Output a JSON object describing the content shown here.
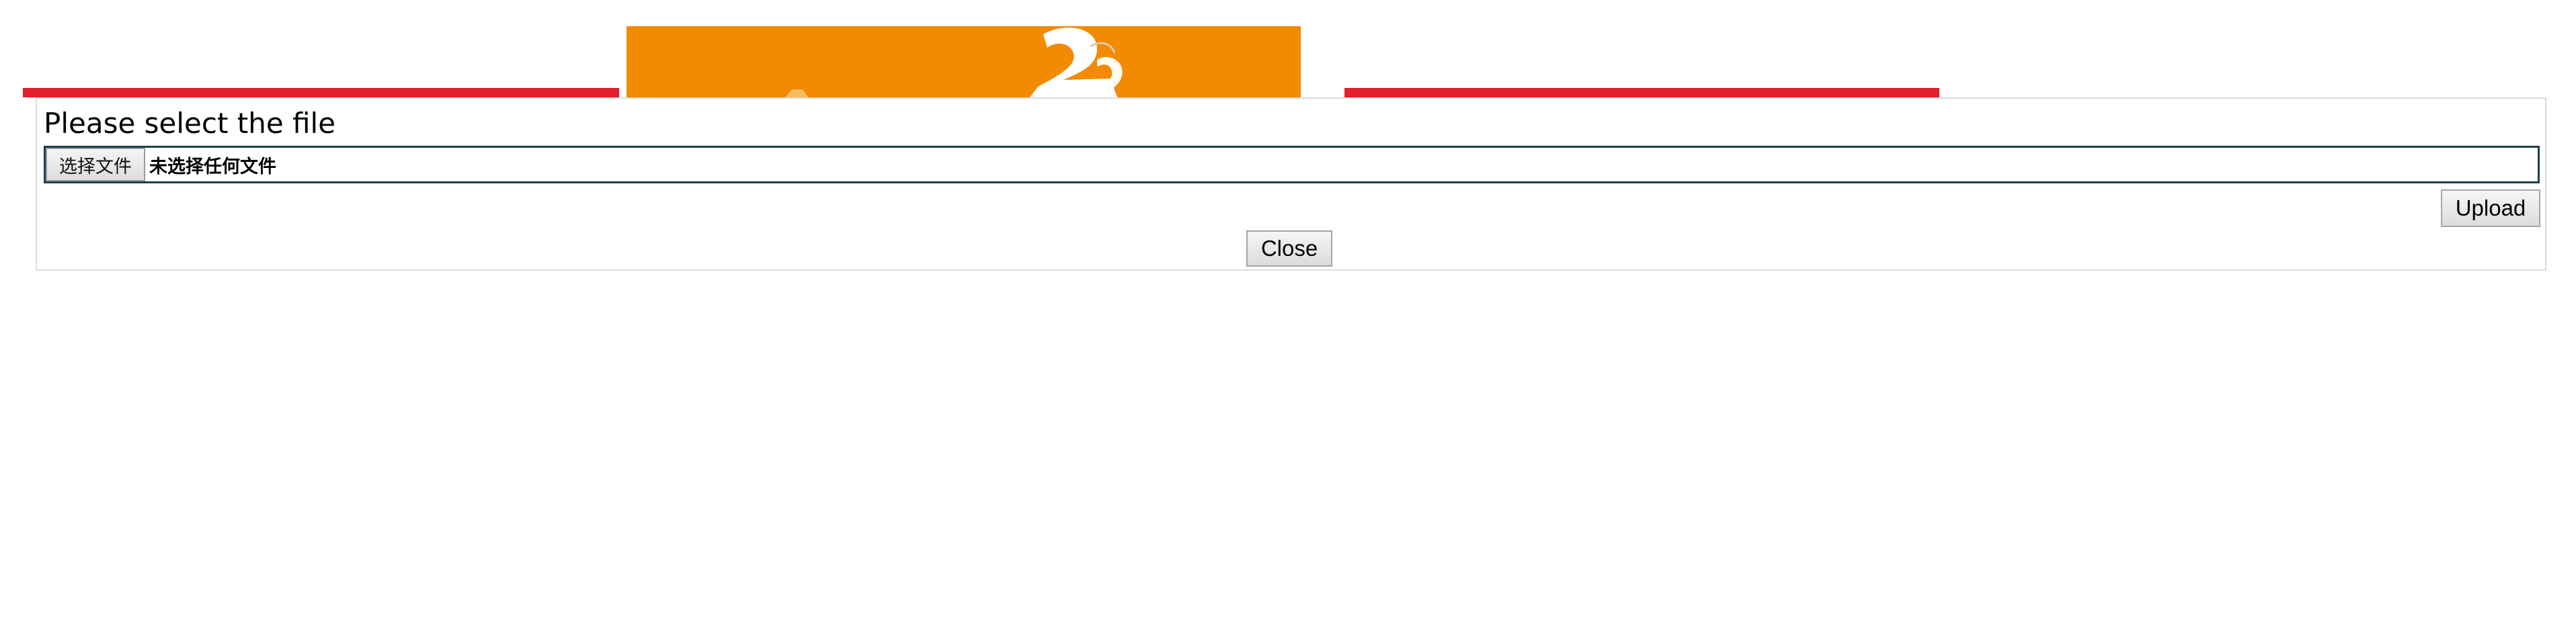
{
  "background": {
    "accent_color": "#e21f2b",
    "logo_color": "#f28a02",
    "logo_icon": "logo-mark-icon"
  },
  "dialog": {
    "title": "Please select the file",
    "file_input": {
      "button_label": "选择文件",
      "status_text": "未选择任何文件"
    },
    "upload_label": "Upload",
    "close_label": "Close"
  }
}
